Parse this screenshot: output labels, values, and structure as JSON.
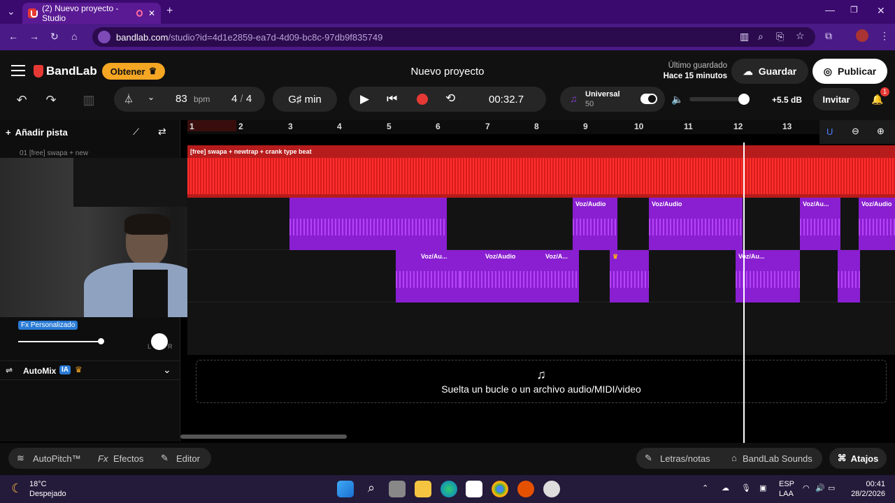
{
  "browser": {
    "tab_title": "(2) Nuevo proyecto - Studio",
    "url_host": "bandlab.com",
    "url_rest": "/studio?id=4d1e2859-ea7d-4d09-bc8c-97db9f835749"
  },
  "header": {
    "brand": "BandLab",
    "get_label": "Obtener",
    "project_title": "Nuevo proyecto",
    "last_saved_label": "Último guardado",
    "last_saved_time": "Hace 15 minutos",
    "save_label": "Guardar",
    "publish_label": "Publicar"
  },
  "transport": {
    "bpm": "83",
    "bpm_unit": "bpm",
    "time_sig_num": "4",
    "time_sig_sep": "/",
    "time_sig_den": "4",
    "key": "G♯ min",
    "time": "00:32.7",
    "instrument_name": "Universal",
    "instrument_value": "50",
    "db": "+5.5 dB",
    "invite_label": "Invitar",
    "notif_count": "1"
  },
  "left": {
    "add_track": "Añadir pista",
    "track1_label": "01 [free] swapa + new",
    "fx_label": "Fx Personalizado",
    "automix_label": "AutoMix",
    "ia_badge": "IA",
    "pan_l": "L",
    "pan_r": "R"
  },
  "ruler": [
    "1",
    "2",
    "3",
    "4",
    "5",
    "6",
    "7",
    "8",
    "9",
    "10",
    "11",
    "12",
    "13"
  ],
  "tracks": {
    "track1_clip": "[free] swapa + newtrap + crank type beat",
    "voz_audio": "Voz/Audio",
    "voz_short": "Voz/Au...",
    "voz_a": "Voz/A..."
  },
  "dropzone": {
    "text": "Suelta un bucle o un archivo audio/MIDI/video"
  },
  "bottombar": {
    "autopitch": "AutoPitch™",
    "effects_prefix": "Fx",
    "effects": "Efectos",
    "editor": "Editor",
    "lyrics": "Letras/notas",
    "sounds_brand": "BandLab",
    "sounds": "Sounds",
    "shortcuts": "Atajos"
  },
  "taskbar": {
    "temp": "18°C",
    "weather": "Despejado",
    "lang1": "ESP",
    "lang2": "LAA",
    "clock_time": "00:41",
    "clock_date": "28/2/2026"
  },
  "colors": {
    "accent_red": "#e53935",
    "clip_purple": "#8a1fd1",
    "get_yellow": "#f5a623",
    "browser_purple": "#3b0a6e"
  }
}
